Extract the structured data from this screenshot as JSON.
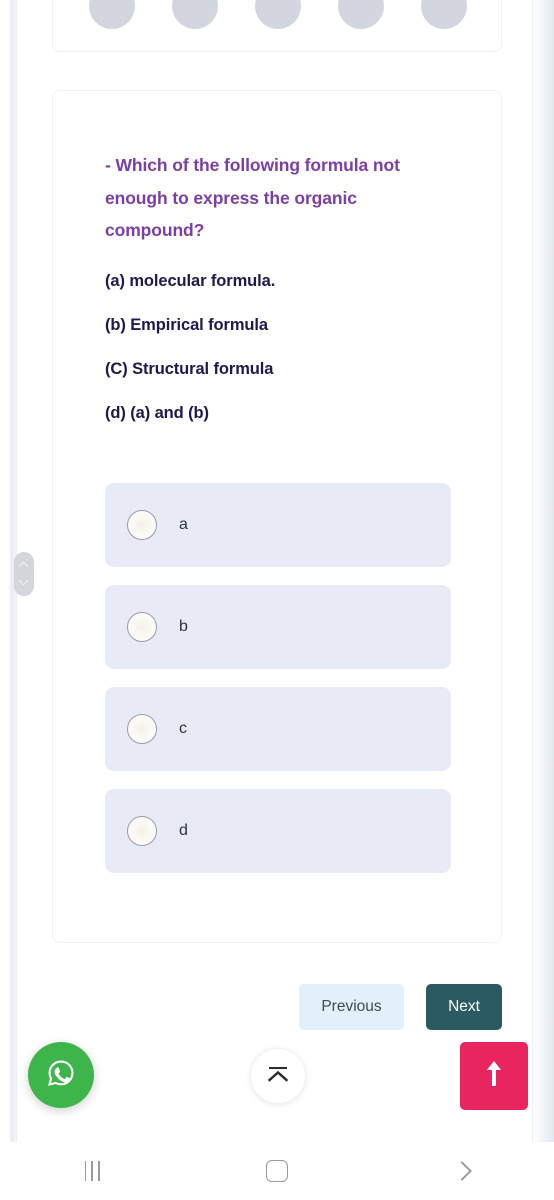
{
  "quiz": {
    "pills": [
      {
        "label": ""
      },
      {
        "label": ""
      },
      {
        "label": ""
      },
      {
        "label": ""
      },
      {
        "label": ""
      }
    ],
    "question": {
      "stem": "- Which of the following formula not enough to express the organic compound?",
      "options_text": [
        "(a) molecular formula.",
        "(b) Empirical formula",
        "(C) Structural formula",
        "(d) (a) and (b)"
      ]
    },
    "choices": [
      {
        "value": "a",
        "label": "a",
        "selected": false
      },
      {
        "value": "b",
        "label": "b",
        "selected": false
      },
      {
        "value": "c",
        "label": "c",
        "selected": false
      },
      {
        "value": "d",
        "label": "d",
        "selected": false
      }
    ],
    "navigation": {
      "previous_label": "Previous",
      "next_label": "Next"
    }
  },
  "floating": {
    "whatsapp_icon": "whatsapp-icon",
    "collapse_icon": "collapse-up-icon",
    "scroll_top_icon": "arrow-up-icon"
  },
  "system_nav": {
    "recents_icon": "recent-apps-icon",
    "home_icon": "home-icon",
    "back_icon": "back-chevron-icon"
  },
  "colors": {
    "question_purple": "#7c3fa3",
    "option_navy": "#1d1a4e",
    "choice_bg": "#e8eaf6",
    "next_btn": "#2b5a62",
    "previous_btn": "#e2f0f9",
    "whatsapp_green": "#3db54a",
    "scroll_top_pink": "#e8255f"
  }
}
